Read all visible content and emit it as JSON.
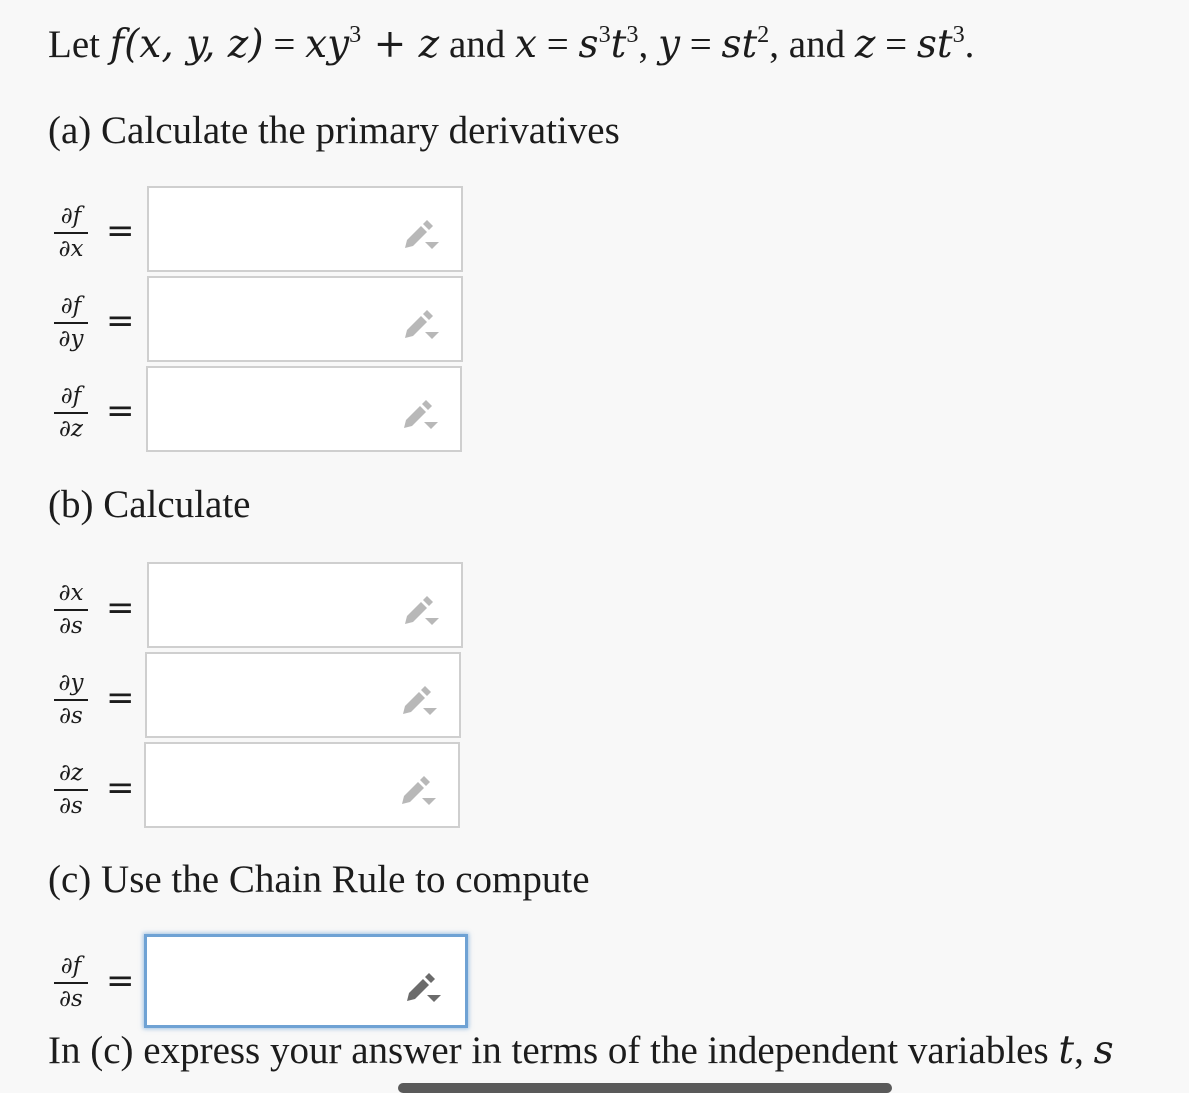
{
  "problem": {
    "let": "Let ",
    "f_def": "f(x, y, z)",
    "eq1": " = ",
    "fx_expr_a": "xy",
    "fx_exp": "3",
    "fx_expr_b": " + z",
    "and1": " and ",
    "x_var": "x",
    "eq2": " = ",
    "x_s": "s",
    "x_s_exp": "3",
    "x_t": "t",
    "x_t_exp": "3",
    "comma1": ", ",
    "y_var": "y",
    "eq3": " = ",
    "y_expr": "st",
    "y_exp": "2",
    "comma_and": ", and ",
    "z_var": "z",
    "eq4": " = ",
    "z_expr": "st",
    "z_exp": "3",
    "period": "."
  },
  "sections": {
    "a": "(a) Calculate the primary derivatives",
    "b": "(b) Calculate",
    "c": "(c) Use the Chain Rule to compute"
  },
  "equals_sign": "=",
  "fields": [
    {
      "num": "∂f",
      "den": "∂x",
      "value": ""
    },
    {
      "num": "∂f",
      "den": "∂y",
      "value": ""
    },
    {
      "num": "∂f",
      "den": "∂z",
      "value": ""
    },
    {
      "num": "∂x",
      "den": "∂s",
      "value": ""
    },
    {
      "num": "∂y",
      "den": "∂s",
      "value": ""
    },
    {
      "num": "∂z",
      "den": "∂s",
      "value": ""
    },
    {
      "num": "∂f",
      "den": "∂s",
      "value": ""
    }
  ],
  "footer": {
    "text": "In (c) express your answer in terms of the independent variables ",
    "var_t": "t",
    "sep": ", ",
    "var_s": "s"
  },
  "colors": {
    "focus_border": "#6fa2d4",
    "pencil": "#b8b8b8",
    "pencil_active": "#6b6b6b"
  },
  "icons": {
    "edit": "pencil-dropdown-icon"
  }
}
